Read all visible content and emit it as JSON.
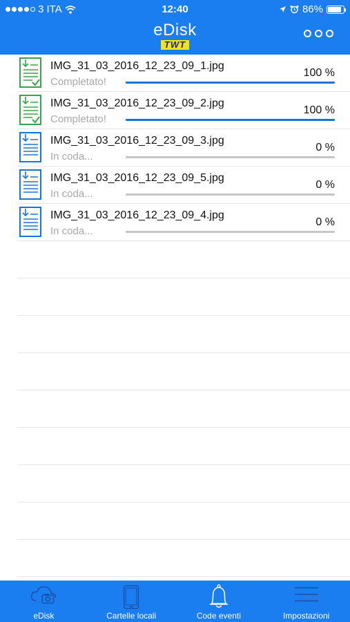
{
  "status_bar": {
    "carrier": "3 ITA",
    "time": "12:40",
    "battery": "86%",
    "battery_level": 0.86
  },
  "header": {
    "logo_main": "eDisk",
    "logo_sub": "TWT",
    "more_icon": "more-circles-icon"
  },
  "transfers": [
    {
      "filename": "IMG_31_03_2016_12_23_09_1.jpg",
      "status": "Completato!",
      "percent": "100 %",
      "progress": 1.0,
      "icon": "file-download-done-icon",
      "color": "#3aa34a"
    },
    {
      "filename": "IMG_31_03_2016_12_23_09_2.jpg",
      "status": "Completato!",
      "percent": "100 %",
      "progress": 1.0,
      "icon": "file-download-done-icon",
      "color": "#3aa34a"
    },
    {
      "filename": "IMG_31_03_2016_12_23_09_3.jpg",
      "status": "In coda...",
      "percent": "0 %",
      "progress": 0.0,
      "icon": "file-download-icon",
      "color": "#1a74d8"
    },
    {
      "filename": "IMG_31_03_2016_12_23_09_5.jpg",
      "status": "In coda...",
      "percent": "0 %",
      "progress": 0.0,
      "icon": "file-download-icon",
      "color": "#1a74d8"
    },
    {
      "filename": "IMG_31_03_2016_12_23_09_4.jpg",
      "status": "In coda...",
      "percent": "0 %",
      "progress": 0.0,
      "icon": "file-download-icon",
      "color": "#1a74d8"
    }
  ],
  "tabs": [
    {
      "label": "eDisk",
      "icon": "cloud-camera-icon"
    },
    {
      "label": "Cartelle locali",
      "icon": "phone-icon"
    },
    {
      "label": "Code eventi",
      "icon": "bell-icon"
    },
    {
      "label": "Impostazioni",
      "icon": "menu-lines-icon"
    }
  ],
  "colors": {
    "brand_blue": "#1a7df0",
    "progress_blue": "#1a74d8",
    "done_green": "#3aa34a",
    "logo_yellow": "#f3e21a"
  }
}
